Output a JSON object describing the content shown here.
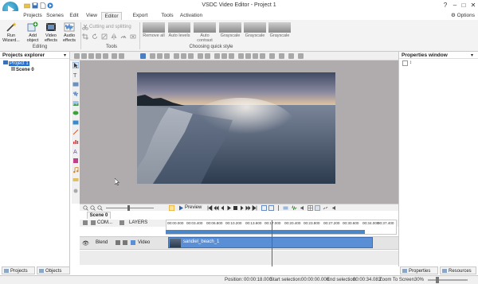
{
  "window": {
    "title": "VSDC Video Editor - Project 1",
    "options_label": "Options"
  },
  "menu": {
    "tabs": [
      "Projects",
      "Scenes",
      "Edit",
      "View",
      "Editor",
      "Export project",
      "Tools",
      "Activation"
    ],
    "active": "Editor"
  },
  "ribbon": {
    "editing": {
      "label": "Editing",
      "buttons": [
        "Run Wizard...",
        "Add object",
        "Video effects",
        "Audio effects"
      ]
    },
    "tools": {
      "label": "Tools",
      "cutting": "Cutting and splitting"
    },
    "quick_style": {
      "label": "Choosing quick style",
      "styles": [
        "Remove all",
        "Auto levels",
        "Auto contrast",
        "Grayscale",
        "Grayscale",
        "Grayscale"
      ]
    }
  },
  "projects_explorer": {
    "title": "Projects explorer",
    "project": "Project 1",
    "scene": "Scene 0"
  },
  "properties": {
    "title": "Properties window"
  },
  "transport": {
    "preview_label": "Preview"
  },
  "timeline": {
    "scene_tab": "Scene 0",
    "header_com": "COM...",
    "header_layers": "LAYERS",
    "ruler": [
      "00:00.000",
      "00:03.400",
      "00:06.800",
      "00:10.200",
      "00:13.600",
      "00:17.000",
      "00:20.400",
      "00:23.800",
      "00:27.200",
      "00:30.600",
      "00:34.000",
      "00:37.400"
    ],
    "track": {
      "blend": "Blend",
      "type": "Video",
      "clip_name": "sandiel_beach_1"
    }
  },
  "bottom_tabs": [
    "Projects ex...",
    "Objects ex...",
    "Properties wi...",
    "Resources wi..."
  ],
  "status": {
    "position_label": "Position:",
    "position": "00:00:18.000",
    "start_label": "Start selection:",
    "start": "00:00:00.000",
    "end_label": "End selection:",
    "end": "00:00:34.083",
    "zoom_label": "Zoom To Screen",
    "zoom": "30%"
  }
}
